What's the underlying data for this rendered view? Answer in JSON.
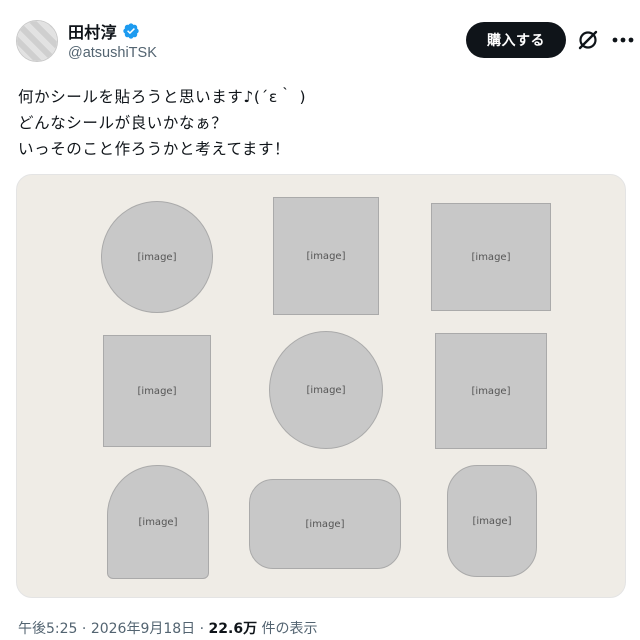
{
  "user": {
    "name": "田村淳",
    "handle": "@atsushiTSK",
    "verified": true
  },
  "actions": {
    "buy_label": "購入する",
    "grok_icon": "grok-icon",
    "more_icon": "more-icon"
  },
  "tweet": {
    "lines": [
      "何かシールを貼ろうと思います♪(´ε｀ )",
      "どんなシールが良いかなぁ？",
      "いっそのこと作ろうかと考えてます！"
    ]
  },
  "meta": {
    "time": "午後5:25",
    "sep1": "·",
    "date": "2026年9月18日",
    "sep2": "·",
    "views_count": "22.6万",
    "views_label": "件の表示"
  },
  "colors": {
    "verified_blue": "#1d9bf0",
    "button_bg": "#0f1419",
    "secondary_text": "#536471"
  }
}
